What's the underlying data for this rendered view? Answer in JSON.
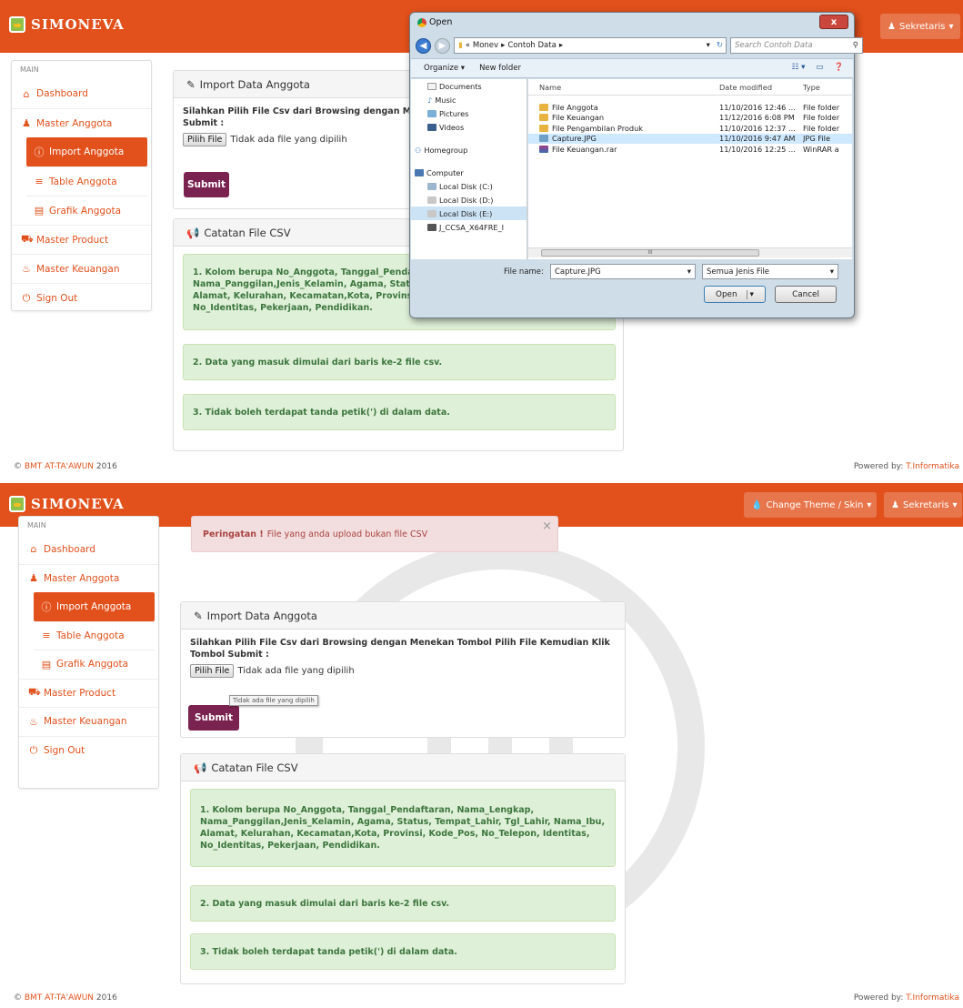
{
  "app": {
    "brand": "SIMONEVA",
    "accent": "#e2501b",
    "submit_color": "#7b2350"
  },
  "nav": {
    "theme_label": "Change Theme / Skin",
    "user_label": "Sekretaris"
  },
  "sidebar": {
    "header": "MAIN",
    "items": [
      {
        "label": "Dashboard",
        "icon": "home-icon"
      },
      {
        "label": "Master Anggota",
        "icon": "user-icon"
      },
      {
        "label": "Import Anggota",
        "icon": "info-circle-icon",
        "active": true
      },
      {
        "label": "Table Anggota",
        "icon": "list-icon"
      },
      {
        "label": "Grafik Anggota",
        "icon": "chart-icon"
      },
      {
        "label": "Master Product",
        "icon": "cart-icon"
      },
      {
        "label": "Master Keuangan",
        "icon": "fire-icon"
      },
      {
        "label": "Sign Out",
        "icon": "power-icon"
      }
    ]
  },
  "import_panel": {
    "title": "Import Data Anggota",
    "instruction": "Silahkan Pilih File Csv dari Browsing dengan Menekan Tombol Pilih File Kemudian Klik Tombol Submit :",
    "instruction_clipped": "Silahkan Pilih File Csv dari Browsing dengan Menek",
    "instruction_clipped_2": "Submit :",
    "file_button": "Pilih File",
    "file_status": "Tidak ada file yang dipilih",
    "submit": "Submit",
    "tooltip": "Tidak ada file yang dipilih"
  },
  "csv_panel": {
    "title": "Catatan File CSV",
    "note1": "1. Kolom berupa No_Anggota, Tanggal_Pendaftaran, Nama_Lengkap, Nama_Panggilan,Jenis_Kelamin, Agama, Status, Tempat_Lahir, Tgl_Lahir, Nama_Ibu, Alamat, Kelurahan, Kecamatan,Kota, Provinsi, Kode_Pos, No_Telepon, Identitas, No_Identitas, Pekerjaan, Pendidikan.",
    "note1_clipped_1": "1. Kolom berupa No_Anggota, Tanggal_Pendaft",
    "note1_clipped_2": "Nama_Panggilan,Jenis_Kelamin, Agama, Status,",
    "note1_clipped_3": "Alamat, Kelurahan, Kecamatan,Kota, Provinsi, K",
    "note1_clipped_4": "No_Identitas, Pekerjaan, Pendidikan.",
    "note2": "2. Data yang masuk dimulai dari baris ke-2 file csv.",
    "note3": "3. Tidak boleh terdapat tanda petik(') di dalam data."
  },
  "alert": {
    "strong": "Peringatan !",
    "text": "File yang anda upload bukan file CSV",
    "close": "×"
  },
  "footer": {
    "copyright": "©",
    "company": "BMT AT-TA'AWUN",
    "year": "2016",
    "powered_label": "Powered by:",
    "powered_link": "T.Informatika"
  },
  "dialog": {
    "title": "Open",
    "path": [
      "«",
      "Monev",
      "Contoh Data"
    ],
    "search_placeholder": "Search Contoh Data",
    "organize": "Organize ▾",
    "new_folder": "New folder",
    "nav_items": [
      "Documents",
      "Music",
      "Pictures",
      "Videos",
      "Homegroup",
      "Computer",
      "Local Disk (C:)",
      "Local Disk (D:)",
      "Local Disk (E:)",
      "J_CCSA_X64FRE_I"
    ],
    "columns": {
      "name": "Name",
      "date": "Date modified",
      "type": "Type"
    },
    "files": [
      {
        "name": "File Anggota",
        "date": "11/10/2016 12:46 ...",
        "type": "File folder",
        "icon": "folder-icon"
      },
      {
        "name": "File Keuangan",
        "date": "11/12/2016 6:08 PM",
        "type": "File folder",
        "icon": "folder-icon"
      },
      {
        "name": "File Pengambilan Produk",
        "date": "11/10/2016 12:37 ...",
        "type": "File folder",
        "icon": "folder-icon"
      },
      {
        "name": "Capture.JPG",
        "date": "11/10/2016 9:47 AM",
        "type": "JPG File",
        "icon": "image-file-icon",
        "selected": true
      },
      {
        "name": "File Keuangan.rar",
        "date": "11/10/2016 12:25 ...",
        "type": "WinRAR a",
        "icon": "rar-file-icon"
      }
    ],
    "filename_label": "File name:",
    "filename_value": "Capture.JPG",
    "filetype_value": "Semua Jenis File",
    "open_button": "Open",
    "cancel_button": "Cancel",
    "close_button": "x",
    "scroll_mark": "III"
  }
}
